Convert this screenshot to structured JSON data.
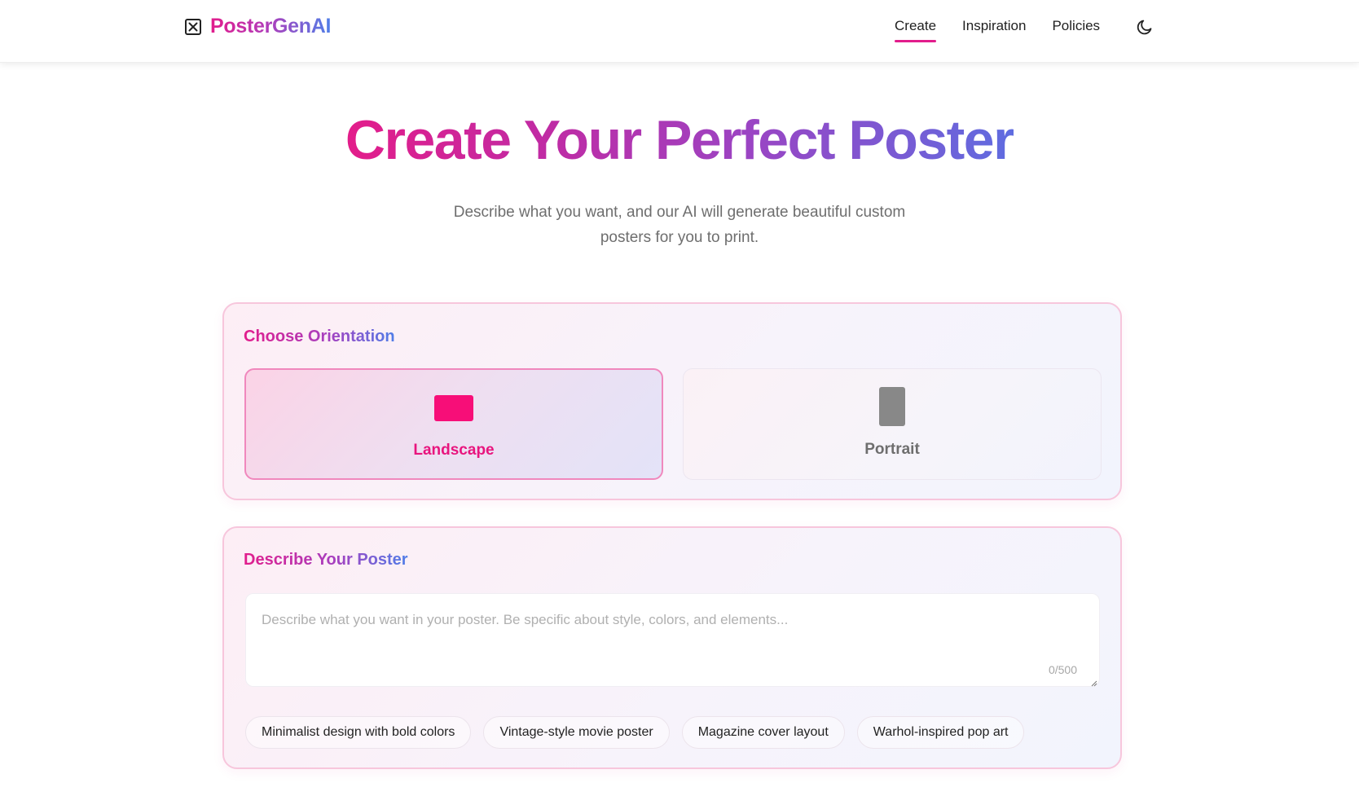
{
  "header": {
    "brand": "PosterGenAI",
    "nav": [
      {
        "label": "Create",
        "active": true
      },
      {
        "label": "Inspiration",
        "active": false
      },
      {
        "label": "Policies",
        "active": false
      }
    ],
    "theme_icon": "moon-icon"
  },
  "hero": {
    "title": "Create Your Perfect Poster",
    "subtitle": "Describe what you want, and our AI will generate beautiful custom posters for you to print."
  },
  "orientation": {
    "title": "Choose Orientation",
    "options": [
      {
        "label": "Landscape",
        "selected": true
      },
      {
        "label": "Portrait",
        "selected": false
      }
    ]
  },
  "describe": {
    "title": "Describe Your Poster",
    "placeholder": "Describe what you want in your poster. Be specific about style, colors, and elements...",
    "value": "",
    "char_count": "0/500",
    "suggestions": [
      "Minimalist design with bold colors",
      "Vintage-style movie poster",
      "Magazine cover layout",
      "Warhol-inspired pop art"
    ]
  },
  "colors": {
    "accent_pink": "#e21d8c",
    "accent_blue": "#4f7ee8",
    "landscape_swatch": "#f70e78",
    "portrait_swatch": "#888888"
  }
}
